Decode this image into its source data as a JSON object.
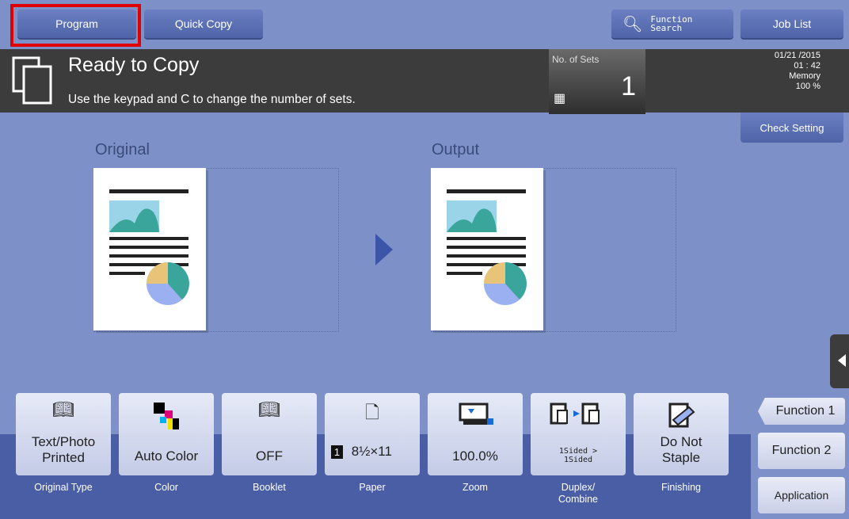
{
  "top_bar": {
    "program": "Program",
    "quick_copy": "Quick Copy",
    "function_search": "Function Search",
    "job_list": "Job List"
  },
  "status": {
    "title": "Ready to Copy",
    "message": "Use the keypad and C to change the number of sets.",
    "sets_label": "No. of Sets",
    "sets_value": "1",
    "date": "01/21 /2015",
    "time": "01 : 42",
    "memory_label": "Memory",
    "memory_value": "100 %"
  },
  "check_setting": "Check Setting",
  "preview": {
    "original_label": "Original",
    "output_label": "Output"
  },
  "functions": [
    {
      "icon": "text-photo-icon",
      "value": "Text/Photo\nPrinted",
      "label": "Original Type"
    },
    {
      "icon": "color-icon",
      "value": "Auto Color",
      "label": "Color"
    },
    {
      "icon": "booklet-icon",
      "value": "OFF",
      "label": "Booklet"
    },
    {
      "icon": "paper-icon",
      "value": "8½×11",
      "label": "Paper",
      "tray": "1"
    },
    {
      "icon": "zoom-icon",
      "value": "100.0%",
      "label": "Zoom"
    },
    {
      "icon": "duplex-icon",
      "value": "1Sided > 1Sided",
      "label": "Duplex/\nCombine"
    },
    {
      "icon": "staple-icon",
      "value": "Do Not\nStaple",
      "label": "Finishing"
    }
  ],
  "side": {
    "function1": "Function 1",
    "function2": "Function 2",
    "application": "Application"
  },
  "colors": {
    "background": "#7d91c8",
    "dark_bar": "#3c3c3c",
    "highlight": "#e00000"
  }
}
